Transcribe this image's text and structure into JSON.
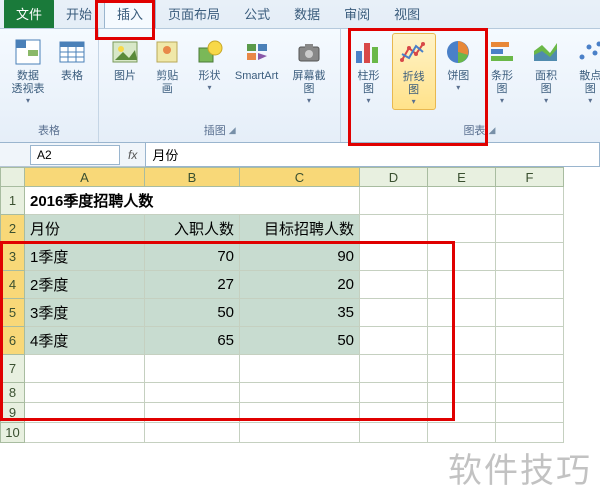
{
  "tabs": {
    "file": "文件",
    "home": "开始",
    "insert": "插入",
    "layout": "页面布局",
    "formulas": "公式",
    "data": "数据",
    "review": "审阅",
    "view": "视图"
  },
  "ribbon": {
    "pivot": "数据\n透视表",
    "table": "表格",
    "picture": "图片",
    "clipart": "剪贴画",
    "shapes": "形状",
    "smartart": "SmartArt",
    "screenshot": "屏幕截图",
    "column": "柱形图",
    "line": "折线图",
    "pie": "饼图",
    "bar": "条形图",
    "area": "面积图",
    "scatter": "散点图",
    "group_tables": "表格",
    "group_illus": "插图",
    "group_charts": "图表"
  },
  "formula": {
    "name": "A2",
    "fx": "fx",
    "value": "月份"
  },
  "columns": [
    "A",
    "B",
    "C",
    "D",
    "E",
    "F"
  ],
  "rows": [
    "1",
    "2",
    "3",
    "4",
    "5",
    "6",
    "7",
    "8",
    "9",
    "10"
  ],
  "sheet": {
    "title": "2016季度招聘人数",
    "headers": [
      "月份",
      "入职人数",
      "目标招聘人数"
    ],
    "data": [
      [
        "1季度",
        "70",
        "90"
      ],
      [
        "2季度",
        "27",
        "20"
      ],
      [
        "3季度",
        "50",
        "35"
      ],
      [
        "4季度",
        "65",
        "50"
      ]
    ]
  },
  "watermark": "软件技巧",
  "chart_data": {
    "type": "table",
    "title": "2016季度招聘人数",
    "categories": [
      "1季度",
      "2季度",
      "3季度",
      "4季度"
    ],
    "series": [
      {
        "name": "入职人数",
        "values": [
          70,
          27,
          50,
          65
        ]
      },
      {
        "name": "目标招聘人数",
        "values": [
          90,
          20,
          35,
          50
        ]
      }
    ]
  }
}
